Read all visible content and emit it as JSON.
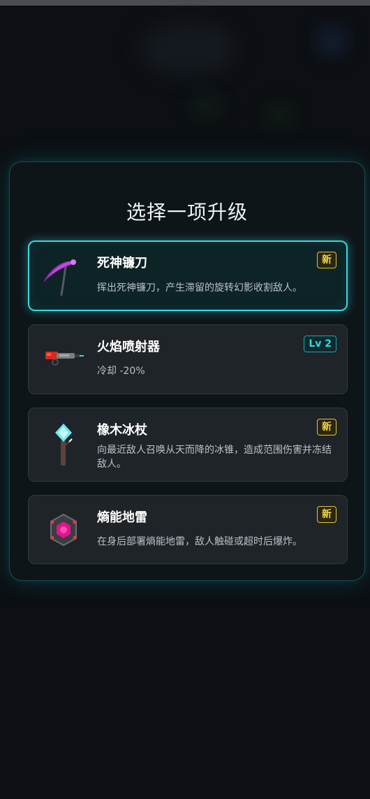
{
  "modal": {
    "title": "选择一项升级"
  },
  "options": [
    {
      "name": "死神镰刀",
      "badge": "新",
      "description": "挥出死神镰刀，产生滞留的旋转幻影收割敌人。",
      "icon": "scythe-icon",
      "selected": true
    },
    {
      "name": "火焰喷射器",
      "badge": "Lv 2",
      "description": "冷却 -20%",
      "icon": "flamethrower-icon",
      "selected": false
    },
    {
      "name": "橡木冰杖",
      "badge": "新",
      "description": "向最近敌人召唤从天而降的冰锥，造成范围伤害并冻结敌人。",
      "icon": "ice-staff-icon",
      "selected": false
    },
    {
      "name": "熵能地雷",
      "badge": "新",
      "description": "在身后部署熵能地雷，敌人触碰或超时后爆炸。",
      "icon": "entropy-mine-icon",
      "selected": false
    }
  ],
  "colors": {
    "accent": "#37d8df",
    "new_badge": "#f2d443",
    "card_bg": "#1f2429",
    "modal_bg": "#0d1519"
  }
}
